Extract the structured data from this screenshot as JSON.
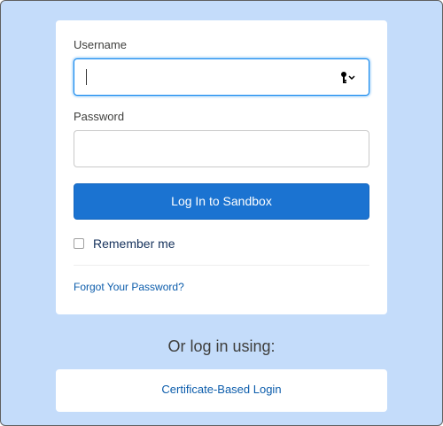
{
  "login_form": {
    "username": {
      "label": "Username",
      "value": "",
      "placeholder": ""
    },
    "password": {
      "label": "Password",
      "value": "",
      "placeholder": ""
    },
    "login_button_label": "Log In to Sandbox",
    "remember_me": {
      "label": "Remember me",
      "checked": false
    },
    "forgot_password_link": "Forgot Your Password?"
  },
  "alternate_login": {
    "heading": "Or log in using:",
    "certificate_link": "Certificate-Based Login"
  },
  "icons": {
    "username_suffix": "key-icon"
  },
  "colors": {
    "page_background": "#c4dcfa",
    "primary_button": "#1b73d1",
    "link": "#0b5cab",
    "focus_ring": "#1589ee"
  }
}
